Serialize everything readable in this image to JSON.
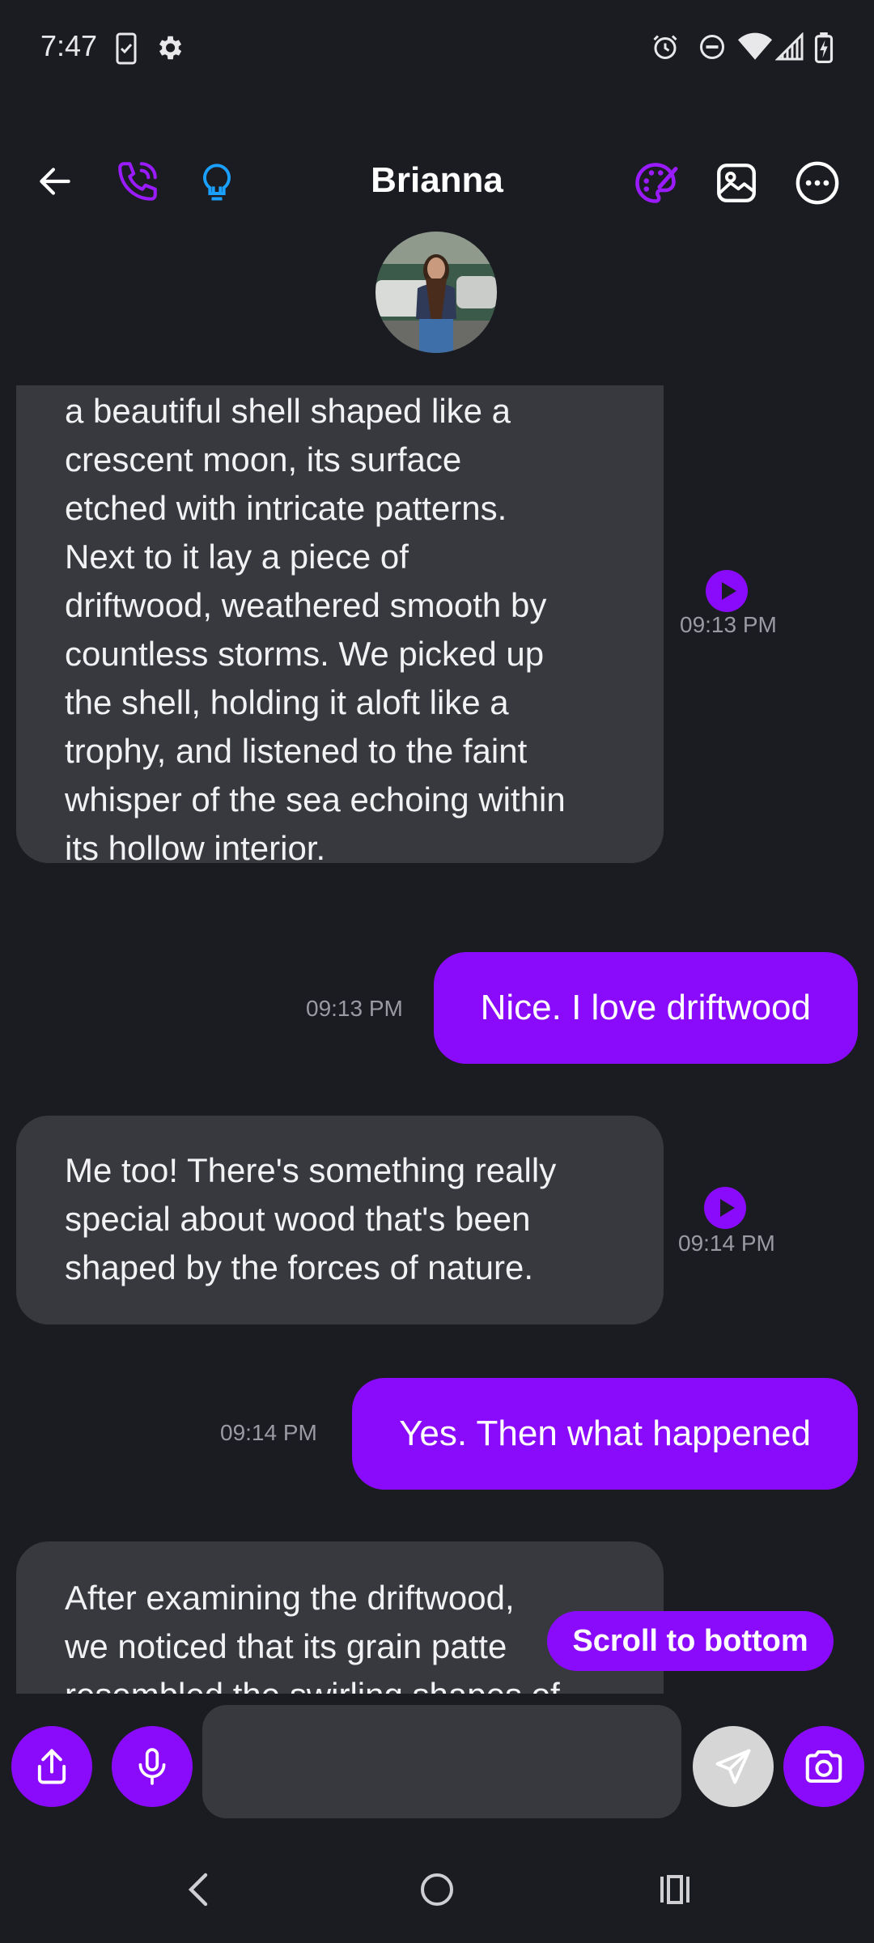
{
  "status_bar": {
    "time": "7:47",
    "icons": [
      "phone-check-icon",
      "gear-icon",
      "alarm-icon",
      "dnd-icon",
      "wifi-icon",
      "signal-icon",
      "battery-charging-icon"
    ]
  },
  "header": {
    "title": "Brianna",
    "left_icons": [
      "back-arrow-icon",
      "phone-call-icon",
      "lightbulb-icon"
    ],
    "right_icons": [
      "palette-icon",
      "image-icon",
      "more-icon"
    ],
    "accent": "#8a0bfb",
    "bulb_color": "#1aa0ff"
  },
  "messages": [
    {
      "from": "bot",
      "lines": [
        "a beautiful shell shaped like a",
        "crescent moon, its surface",
        "etched with intricate patterns.",
        "Next to it lay a piece of",
        "driftwood, weathered smooth by",
        "countless storms. We picked up",
        "the shell, holding it aloft like a",
        "trophy, and listened to the faint",
        "whisper of the sea echoing within",
        "its hollow interior."
      ],
      "time": "09:13 PM"
    },
    {
      "from": "user",
      "text": "Nice. I love driftwood",
      "time": "09:13 PM"
    },
    {
      "from": "bot",
      "lines": [
        "Me too! There's something really",
        "special about wood that's been",
        "shaped by the forces of nature."
      ],
      "time": "09:14 PM"
    },
    {
      "from": "user",
      "text": "Yes. Then what happened",
      "time": "09:14 PM"
    },
    {
      "from": "bot",
      "lines": [
        "After examining the driftwood,",
        "we noticed that its grain patte",
        "resembled the swirling shapes of"
      ]
    }
  ],
  "scroll_button": "Scroll to bottom",
  "input": {
    "placeholder": ""
  }
}
